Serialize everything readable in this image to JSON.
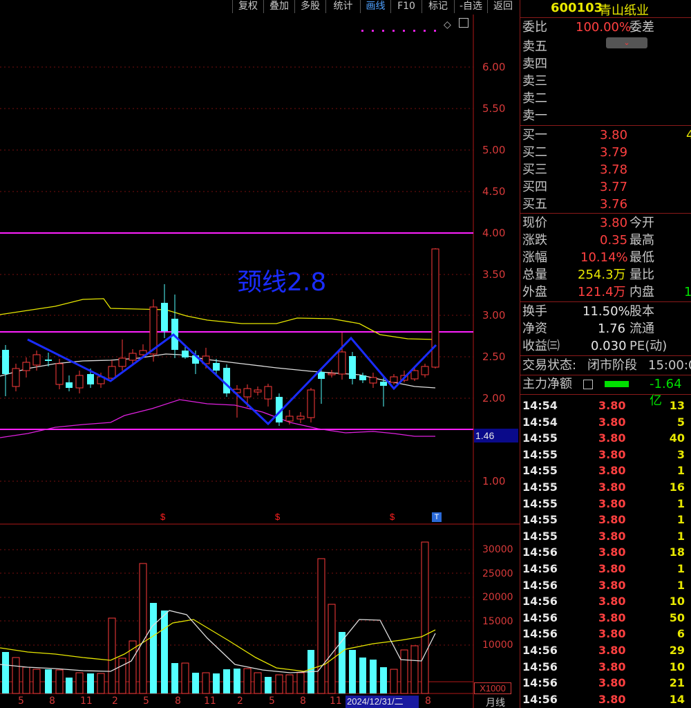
{
  "toolbar": {
    "buttons": [
      "复权",
      "叠加",
      "多股",
      "统计",
      "画线",
      "F10",
      "标记",
      "-自选",
      "返回"
    ],
    "active": "画线"
  },
  "chart": {
    "price_axis": [
      "6.00",
      "5.50",
      "5.00",
      "4.50",
      "4.00",
      "3.50",
      "3.00",
      "2.50",
      "2.00",
      "1.00"
    ],
    "crosshair_value": "1.46",
    "annotation": "颈线2.8",
    "volume_axis": [
      "30000",
      "25000",
      "20000",
      "15000",
      "10000"
    ],
    "volume_unit": "X1000",
    "x_axis": [
      "5",
      "8",
      "11",
      "2",
      "5",
      "8",
      "11",
      "2",
      "5",
      "8",
      "11",
      "8"
    ],
    "date_label": "2024/12/31/二",
    "period_label": "月线",
    "markers": [
      "$",
      "$",
      "$"
    ],
    "t_marker": "T",
    "colors": {
      "up": "#ff3b3b",
      "down": "#54ffff",
      "ma_white": "#e0e0e0",
      "ma_yellow": "#e8e800",
      "ma_magenta": "#e020e0",
      "trendline": "#1a2cff",
      "hline": "#ff20ff"
    }
  },
  "panel": {
    "code": "600103",
    "name": "青山纸业",
    "ratio_label": "委比",
    "ratio_value": "100.00%",
    "diff_label": "委差",
    "sells": [
      "卖五",
      "卖四",
      "卖三",
      "卖二",
      "卖一"
    ],
    "buys": [
      {
        "label": "买一",
        "price": "3.80",
        "vol": "4"
      },
      {
        "label": "买二",
        "price": "3.79"
      },
      {
        "label": "买三",
        "price": "3.78"
      },
      {
        "label": "买四",
        "price": "3.77"
      },
      {
        "label": "买五",
        "price": "3.76"
      }
    ],
    "stats": [
      {
        "l1": "现价",
        "v1": "3.80",
        "c1": "red",
        "l2": "今开"
      },
      {
        "l1": "涨跌",
        "v1": "0.35",
        "c1": "red",
        "l2": "最高"
      },
      {
        "l1": "涨幅",
        "v1": "10.14%",
        "c1": "red",
        "l2": "最低"
      },
      {
        "l1": "总量",
        "v1": "254.3万",
        "c1": "yel",
        "l2": "量比"
      },
      {
        "l1": "外盘",
        "v1": "121.4万",
        "c1": "red",
        "l2": "内盘",
        "v2": "1",
        "c2": "grn"
      }
    ],
    "stats2": [
      {
        "l1": "换手",
        "v1": "11.50%",
        "l2": "股本"
      },
      {
        "l1": "净资",
        "v1": "1.76",
        "l2": "流通"
      },
      {
        "l1": "收益㈢",
        "v1": "0.030",
        "l2": "PE(动)"
      }
    ],
    "status_label": "交易状态:",
    "status_value": "闭市阶段",
    "status_time": "15:00:0",
    "flow_label": "主力净额",
    "flow_value": "-1.64亿",
    "ticks": [
      {
        "t": "14:54",
        "p": "3.80",
        "v": "13"
      },
      {
        "t": "14:54",
        "p": "3.80",
        "v": "5"
      },
      {
        "t": "14:55",
        "p": "3.80",
        "v": "40"
      },
      {
        "t": "14:55",
        "p": "3.80",
        "v": "3"
      },
      {
        "t": "14:55",
        "p": "3.80",
        "v": "1"
      },
      {
        "t": "14:55",
        "p": "3.80",
        "v": "16"
      },
      {
        "t": "14:55",
        "p": "3.80",
        "v": "1"
      },
      {
        "t": "14:55",
        "p": "3.80",
        "v": "1"
      },
      {
        "t": "14:55",
        "p": "3.80",
        "v": "1"
      },
      {
        "t": "14:56",
        "p": "3.80",
        "v": "18"
      },
      {
        "t": "14:56",
        "p": "3.80",
        "v": "1"
      },
      {
        "t": "14:56",
        "p": "3.80",
        "v": "1"
      },
      {
        "t": "14:56",
        "p": "3.80",
        "v": "10"
      },
      {
        "t": "14:56",
        "p": "3.80",
        "v": "50"
      },
      {
        "t": "14:56",
        "p": "3.80",
        "v": "6"
      },
      {
        "t": "14:56",
        "p": "3.80",
        "v": "29"
      },
      {
        "t": "14:56",
        "p": "3.80",
        "v": "10"
      },
      {
        "t": "14:56",
        "p": "3.80",
        "v": "21"
      },
      {
        "t": "14:56",
        "p": "3.80",
        "v": "14"
      }
    ]
  }
}
